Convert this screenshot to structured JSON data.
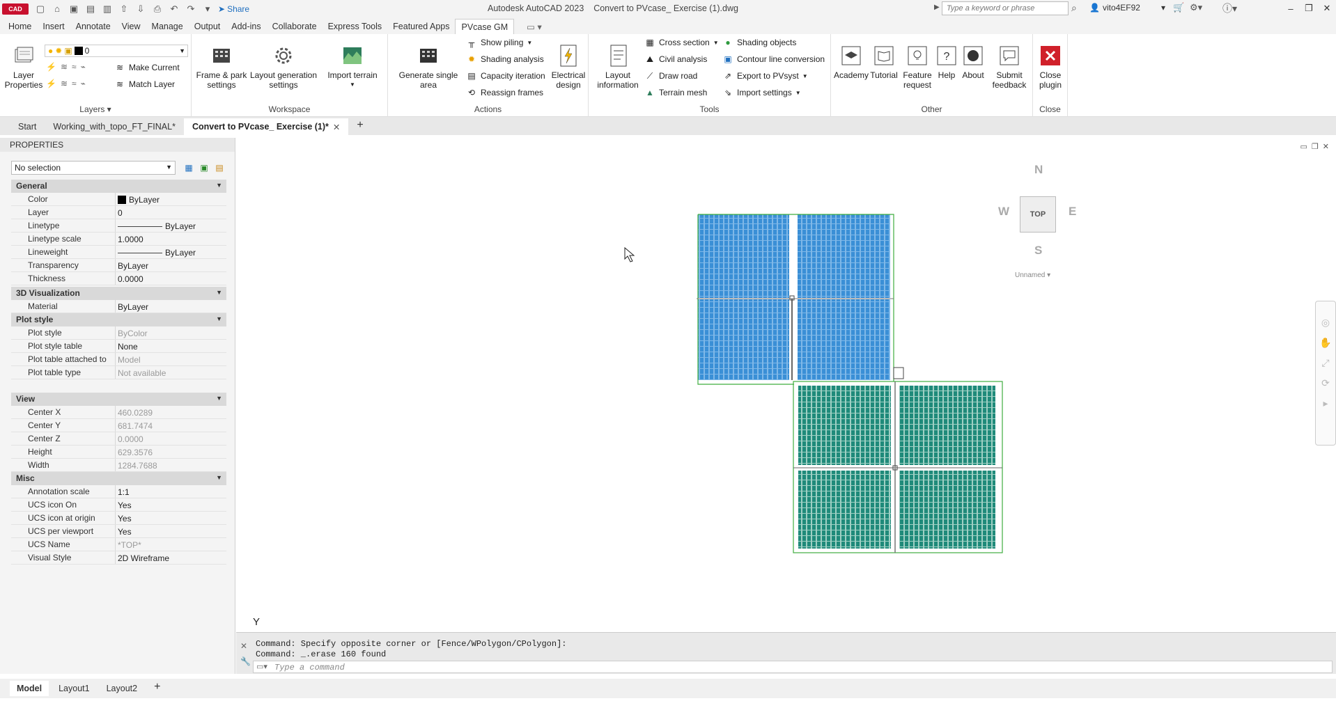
{
  "app": {
    "logo": "CAD",
    "product": "Autodesk AutoCAD 2023",
    "filename": "Convert to PVcase_ Exercise (1).dwg",
    "share": "Share",
    "search_placeholder": "Type a keyword or phrase",
    "user": "vito4EF92"
  },
  "ribbon_tabs": [
    "Home",
    "Insert",
    "Annotate",
    "View",
    "Manage",
    "Output",
    "Add-ins",
    "Collaborate",
    "Express Tools",
    "Featured Apps",
    "PVcase GM"
  ],
  "active_tab": "PVcase GM",
  "ribbon": {
    "layers": {
      "title": "Layers",
      "layer_properties": "Layer Properties",
      "layer_value": "0",
      "make_current": "Make Current",
      "match_layer": "Match Layer"
    },
    "workspace": {
      "title": "Workspace",
      "frame_park": "Frame & park settings",
      "layout_gen": "Layout generation settings",
      "import_terrain": "Import terrain"
    },
    "actions": {
      "title": "Actions",
      "generate_single": "Generate single area",
      "show_piling": "Show piling",
      "shading_analysis": "Shading analysis",
      "capacity_iteration": "Capacity iteration",
      "reassign_frames": "Reassign frames",
      "electrical_design": "Electrical design"
    },
    "tools": {
      "title": "Tools",
      "layout_information": "Layout information",
      "cross_section": "Cross section",
      "civil_analysis": "Civil analysis",
      "draw_road": "Draw road",
      "terrain_mesh": "Terrain mesh",
      "shading_objects": "Shading objects",
      "contour_line_conversion": "Contour line conversion",
      "export_pvsyst": "Export to PVsyst",
      "import_settings": "Import settings"
    },
    "other": {
      "title": "Other",
      "academy": "Academy",
      "tutorial": "Tutorial",
      "feature_request": "Feature request",
      "help": "Help",
      "about": "About",
      "submit_feedback": "Submit feedback"
    },
    "close": {
      "title": "Close",
      "close_plugin": "Close plugin"
    }
  },
  "file_tabs": [
    "Start",
    "Working_with_topo_FT_FINAL*",
    "Convert to PVcase_ Exercise (1)*"
  ],
  "properties": {
    "title": "PROPERTIES",
    "selection": "No selection",
    "sections": {
      "general": "General",
      "viz3d": "3D Visualization",
      "plot": "Plot style",
      "view": "View",
      "misc": "Misc"
    },
    "general": [
      [
        "Color",
        "ByLayer"
      ],
      [
        "Layer",
        "0"
      ],
      [
        "Linetype",
        "ByLayer"
      ],
      [
        "Linetype scale",
        "1.0000"
      ],
      [
        "Lineweight",
        "ByLayer"
      ],
      [
        "Transparency",
        "ByLayer"
      ],
      [
        "Thickness",
        "0.0000"
      ]
    ],
    "viz3d": [
      [
        "Material",
        "ByLayer"
      ]
    ],
    "plot": [
      [
        "Plot style",
        "ByColor"
      ],
      [
        "Plot style table",
        "None"
      ],
      [
        "Plot table attached to",
        "Model"
      ],
      [
        "Plot table type",
        "Not available"
      ]
    ],
    "view": [
      [
        "Center X",
        "460.0289"
      ],
      [
        "Center Y",
        "681.7474"
      ],
      [
        "Center Z",
        "0.0000"
      ],
      [
        "Height",
        "629.3576"
      ],
      [
        "Width",
        "1284.7688"
      ]
    ],
    "misc": [
      [
        "Annotation scale",
        "1:1"
      ],
      [
        "UCS icon On",
        "Yes"
      ],
      [
        "UCS icon at origin",
        "Yes"
      ],
      [
        "UCS per viewport",
        "Yes"
      ],
      [
        "UCS Name",
        "*TOP*"
      ],
      [
        "Visual Style",
        "2D Wireframe"
      ]
    ]
  },
  "viewcube": {
    "n": "N",
    "s": "S",
    "e": "E",
    "w": "W",
    "top": "TOP",
    "ucs": "Unnamed"
  },
  "ucs_y": "Y",
  "command": {
    "line1": "Command: Specify opposite corner or [Fence/WPolygon/CPolygon]:",
    "line2": "Command: _.erase 160 found",
    "input_placeholder": "Type a command"
  },
  "layout_tabs": [
    "Model",
    "Layout1",
    "Layout2"
  ],
  "colors": {
    "pv_blue": "#3a8fd6",
    "pv_teal": "#1f8a7a",
    "boundary": "#3fae3f"
  }
}
